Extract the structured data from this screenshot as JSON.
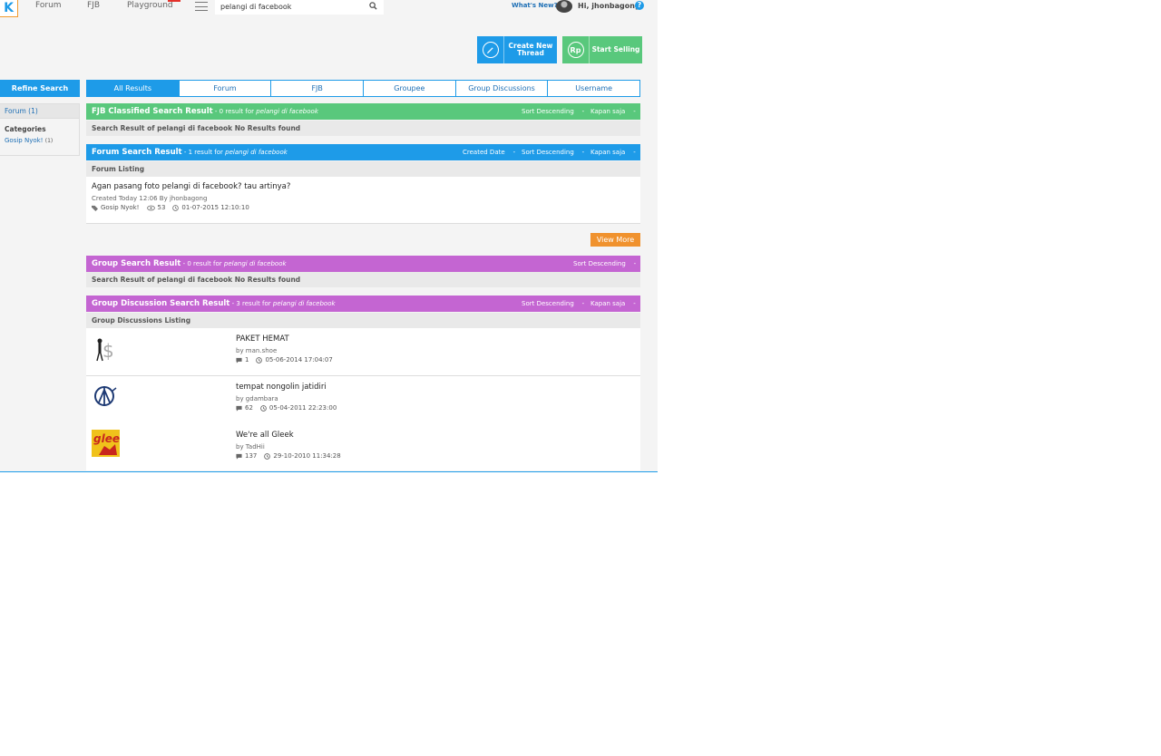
{
  "nav": {
    "logo": "K",
    "links": [
      "Forum",
      "FJB",
      "Playground"
    ],
    "search_value": "pelangi di facebook",
    "whats_new": "What's New?",
    "greeting": "Hi, jhonbagong",
    "help": "?"
  },
  "actions": {
    "create_thread": "Create New Thread",
    "start_selling": "Start Selling",
    "rp_glyph": "Rp"
  },
  "sidebar": {
    "refine": "Refine Search",
    "forum_filter": "Forum (1)",
    "categories_label": "Categories",
    "category_item": "Gosip Nyok!",
    "category_count": "(1)"
  },
  "tabs": [
    "All Results",
    "Forum",
    "FJB",
    "Groupee",
    "Group Discussions",
    "Username"
  ],
  "fjb": {
    "title": "FJB Classified Search Result",
    "count": " - 0 result for ",
    "query": "pelangi di facebook",
    "sort": "Sort Descending",
    "time": "Kapan saja",
    "empty": "Search Result of pelangi di facebook No Results found"
  },
  "forum": {
    "title": "Forum Search Result",
    "count": " - 1 result for ",
    "query": "pelangi di facebook",
    "created": "Created Date",
    "sort": "Sort Descending",
    "time": "Kapan saja",
    "listing": "Forum Listing",
    "thread": {
      "title": "Agan pasang foto pelangi di facebook? tau artinya?",
      "created": "Created Today 12:06 By jhonbagong",
      "tag": "Gosip Nyok!",
      "views": "53",
      "date": "01-07-2015 12:10:10"
    },
    "view_more": "View More"
  },
  "group": {
    "title": "Group Search Result",
    "count": " - 0 result for ",
    "query": "pelangi di facebook",
    "sort": "Sort Descending",
    "empty": "Search Result of pelangi di facebook No Results found"
  },
  "group_discussion": {
    "title": "Group Discussion Search Result",
    "count": " - 3 result for ",
    "query": "pelangi di facebook",
    "sort": "Sort Descending",
    "time": "Kapan saja",
    "listing": "Group Discussions Listing",
    "items": [
      {
        "title": "PAKET HEMAT",
        "by": "by man.shoe",
        "replies": "1",
        "date": "05-06-2014 17:04:07",
        "thumb_text": ""
      },
      {
        "title": "tempat nongolin jatidiri",
        "by": "by gdambara",
        "replies": "62",
        "date": "05-04-2011 22:23:00",
        "thumb_text": ""
      },
      {
        "title": "We're all Gleek",
        "by": "by TadHii",
        "replies": "137",
        "date": "29-10-2010 11:34:28",
        "thumb_text": "glee"
      }
    ]
  },
  "colors": {
    "blue": "#1e9be8",
    "green": "#59c87c",
    "purple": "#c465d2",
    "orange": "#f0922e"
  }
}
